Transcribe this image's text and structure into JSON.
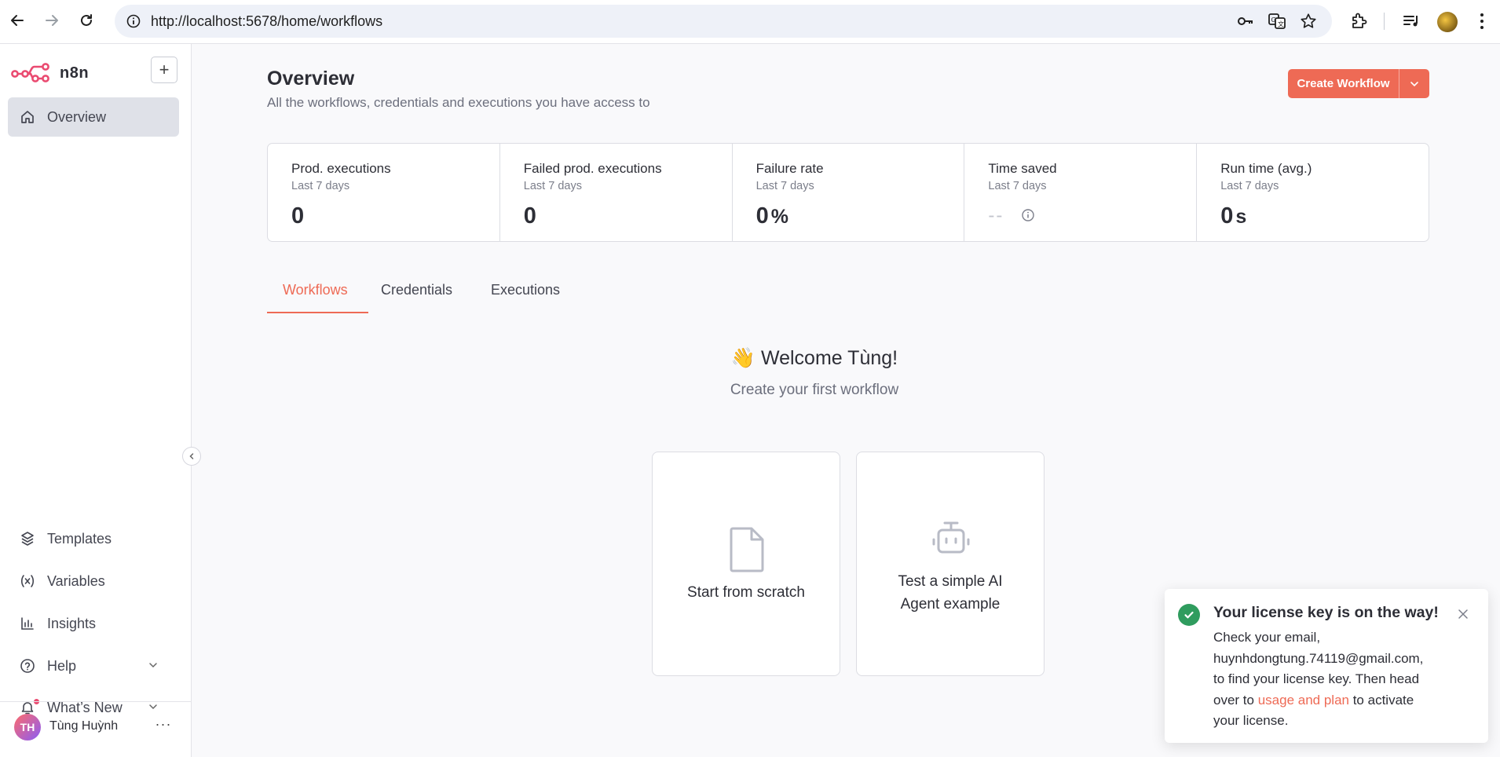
{
  "browser": {
    "url": "http://localhost:5678/home/workflows"
  },
  "app": {
    "name": "n8n",
    "brand_color": "#ea4b71",
    "accent_color": "#ee6a55"
  },
  "sidebar": {
    "add_label": "+",
    "nav_items": [
      {
        "label": "Overview",
        "icon": "home-icon",
        "active": true
      }
    ],
    "bottom_items": [
      {
        "label": "Templates",
        "icon": "templates-icon"
      },
      {
        "label": "Variables",
        "icon": "variables-icon"
      },
      {
        "label": "Insights",
        "icon": "insights-icon"
      },
      {
        "label": "Help",
        "icon": "help-icon"
      },
      {
        "label": "What’s New",
        "icon": "bell-icon"
      }
    ],
    "user": {
      "initials": "TH",
      "name": "Tùng Huỳnh",
      "more": "···"
    }
  },
  "header": {
    "title": "Overview",
    "subtitle": "All the workflows, credentials and executions you have access to",
    "create_button": "Create Workflow"
  },
  "stats": [
    {
      "title": "Prod. executions",
      "period": "Last 7 days",
      "value": "0",
      "unit": ""
    },
    {
      "title": "Failed prod. executions",
      "period": "Last 7 days",
      "value": "0",
      "unit": ""
    },
    {
      "title": "Failure rate",
      "period": "Last 7 days",
      "value": "0",
      "unit": "%"
    },
    {
      "title": "Time saved",
      "period": "Last 7 days",
      "value": "--",
      "unit": ""
    },
    {
      "title": "Run time (avg.)",
      "period": "Last 7 days",
      "value": "0",
      "unit": "s"
    }
  ],
  "tabs": [
    {
      "label": "Workflows",
      "active": true
    },
    {
      "label": "Credentials",
      "active": false
    },
    {
      "label": "Executions",
      "active": false
    }
  ],
  "welcome": {
    "emoji": "👋",
    "title": "Welcome Tùng!",
    "subtitle": "Create your first workflow"
  },
  "cards": [
    {
      "label": "Start from scratch",
      "icon": "file-icon"
    },
    {
      "label_line1": "Test a simple AI",
      "label_line2": "Agent example",
      "icon": "robot-icon"
    }
  ],
  "toast": {
    "title": "Your license key is on the way!",
    "line1": "Check your email,",
    "line2": "huynhdongtung.74119@gmail.com,",
    "line3": "to find your license key. Then head",
    "line4_pre": "over to ",
    "link": "usage and plan",
    "line4_post": " to activate",
    "line5": "your license."
  }
}
